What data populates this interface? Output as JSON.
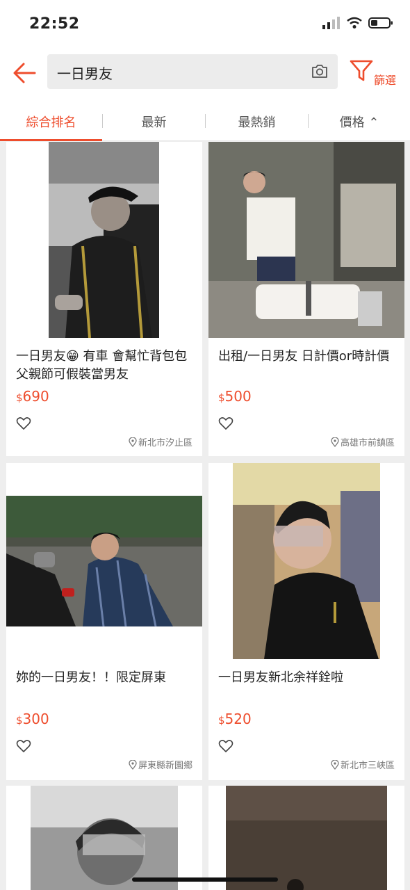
{
  "status_bar": {
    "time": "22:52"
  },
  "search": {
    "query": "一日男友"
  },
  "filter": {
    "label": "篩選"
  },
  "tabs": [
    {
      "label": "綜合排名",
      "active": true
    },
    {
      "label": "最新",
      "active": false
    },
    {
      "label": "最熱銷",
      "active": false
    },
    {
      "label": "價格 ⌃",
      "active": false
    }
  ],
  "products": [
    {
      "title": "一日男友😁 有車 會幫忙背包包 父親節可假裝當男友",
      "currency": "$",
      "price": "690",
      "location": "新北市汐止區"
    },
    {
      "title": "出租/一日男友 日計價or時計價",
      "currency": "$",
      "price": "500",
      "location": "高雄市前鎮區"
    },
    {
      "title": "妳的一日男友！！限定屏東",
      "currency": "$",
      "price": "300",
      "location": "屏東縣新園鄉"
    },
    {
      "title": "一日男友新北余祥銓啦",
      "currency": "$",
      "price": "520",
      "location": "新北市三峽區"
    }
  ],
  "colors": {
    "accent": "#ee4d2d",
    "background": "#eeeeee"
  },
  "icons": [
    "back-arrow-icon",
    "camera-icon",
    "filter-funnel-icon",
    "heart-icon",
    "location-pin-icon",
    "signal-icon",
    "wifi-icon",
    "battery-icon"
  ]
}
